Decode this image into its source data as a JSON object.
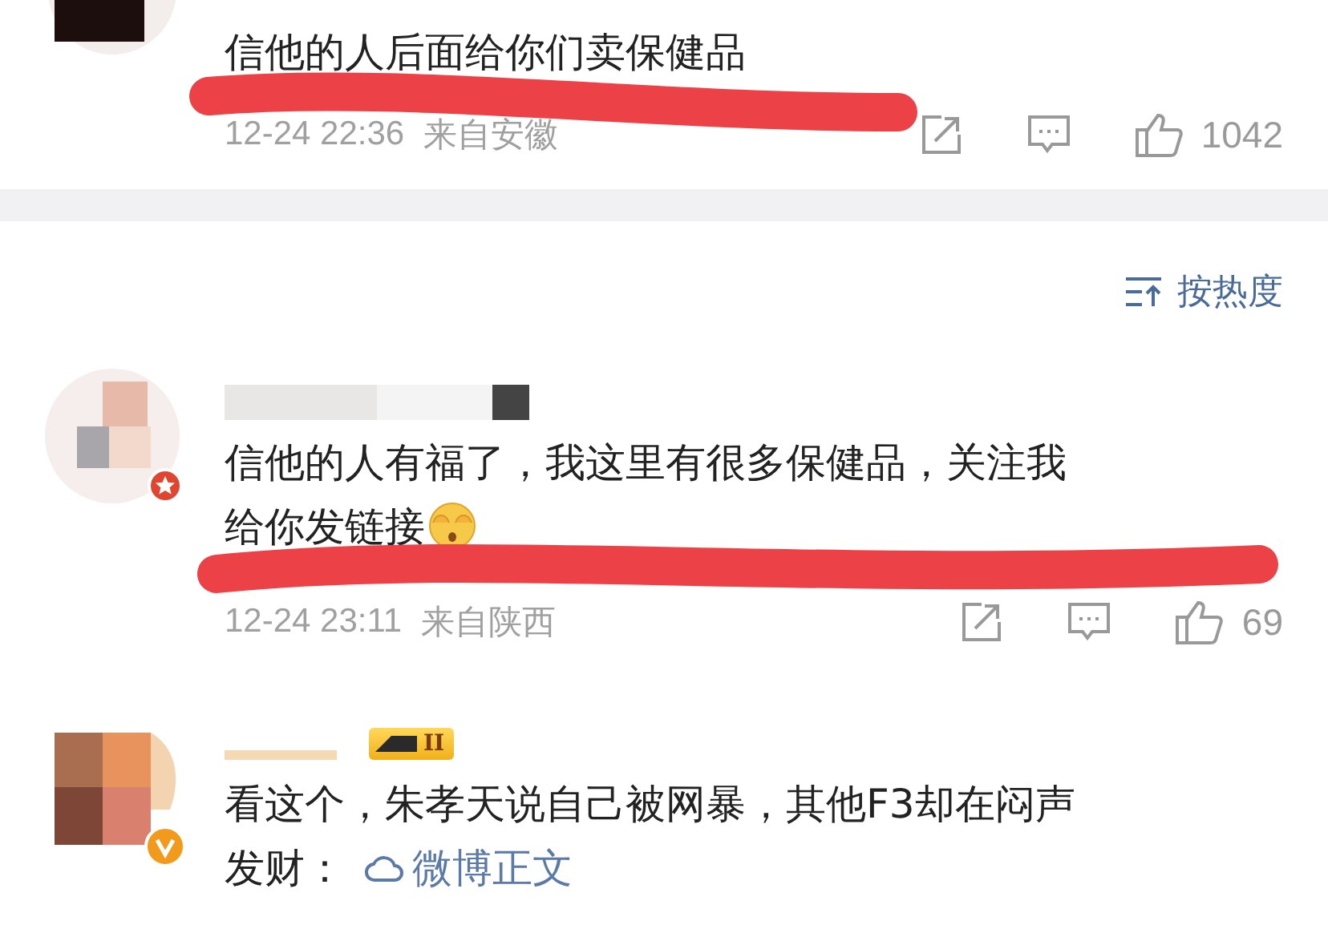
{
  "comments": [
    {
      "text_lines": [
        "信他的人后面给你们卖保健品"
      ],
      "meta": {
        "time": "12-24 22:36",
        "location": "来自安徽",
        "likes": "1042"
      },
      "scribbled": true
    },
    {
      "text_lines": [
        "信他的人有福了，我这里有很多保健品，关注我",
        "给你发链接"
      ],
      "emoji": true,
      "meta": {
        "time": "12-24 23:11",
        "location": "来自陕西",
        "likes": "69"
      },
      "scribbled": true
    },
    {
      "level_badge": "II",
      "text_lines": [
        "看这个，朱孝天说自己被网暴，其他F3却在闷声",
        "发财："
      ],
      "link": "微博正文"
    }
  ],
  "sort": {
    "label": "按热度"
  }
}
